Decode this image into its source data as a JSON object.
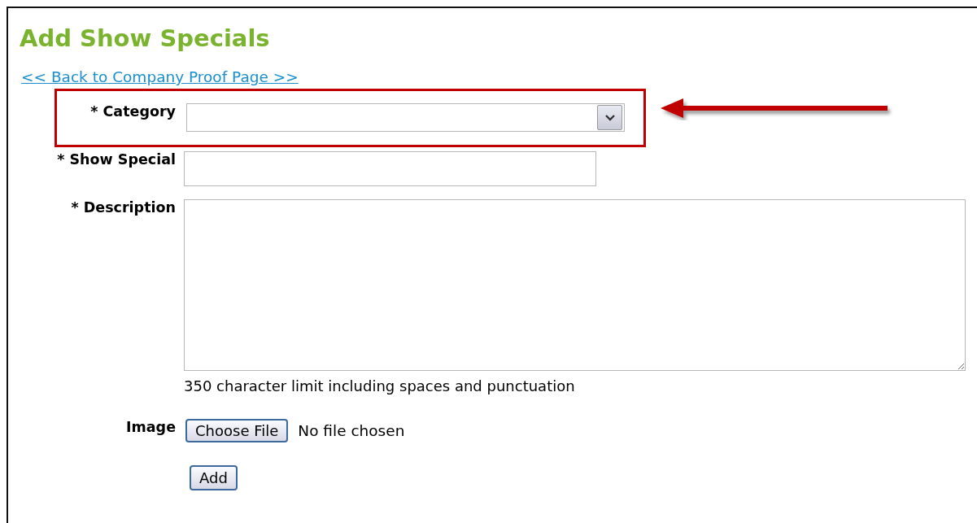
{
  "title": "Add Show Specials",
  "back_link": "<< Back to Company Proof Page >>",
  "fields": [
    {
      "kind": "select",
      "label": "* Category",
      "highlighted": true
    },
    {
      "kind": "text",
      "label": "* Show Special",
      "highlighted": false
    },
    {
      "kind": "textarea",
      "label": "* Description",
      "highlighted": false,
      "hint": "350 character limit including spaces and punctuation"
    },
    {
      "kind": "file",
      "label": "Image",
      "highlighted": false,
      "button": "Choose File",
      "status": "No file chosen"
    }
  ],
  "submit": "Add"
}
